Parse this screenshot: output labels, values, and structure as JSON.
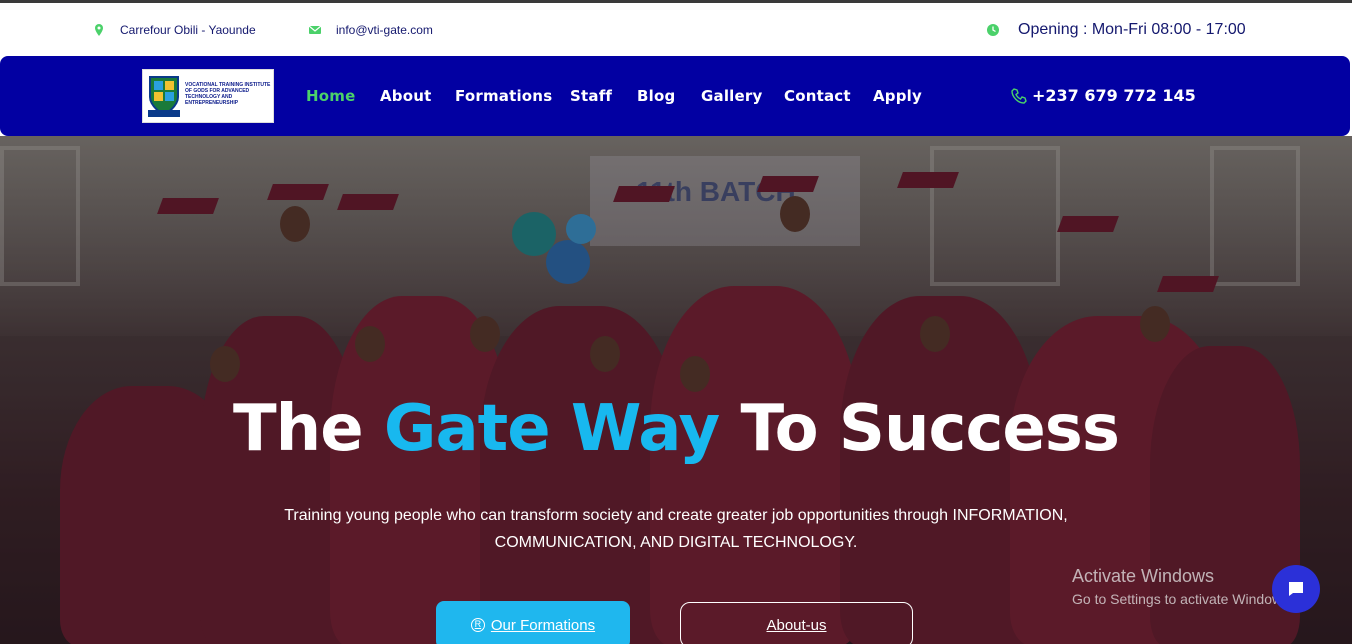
{
  "topbar": {
    "location": "Carrefour Obili - Yaounde",
    "email": "info@vti-gate.com",
    "opening": "Opening : Mon-Fri 08:00 - 17:00"
  },
  "logo": {
    "text": "VOCATIONAL TRAINING INSTITUTE OF GODS FOR ADVANCED TECHNOLOGY AND ENTREPRENEURSHIP",
    "badge": "VTI-GATE"
  },
  "nav": {
    "items": [
      "Home",
      "About",
      "Formations",
      "Staff",
      "Blog",
      "Gallery",
      "Contact",
      "Apply"
    ],
    "active": "Home",
    "phone": "+237 679 772 145"
  },
  "hero": {
    "title_part1": "The",
    "title_highlight": "Gate Way",
    "title_part2": "To Success",
    "subtitle": "Training young people who can transform society and create greater job opportunities through INFORMATION, COMMUNICATION, AND DIGITAL TECHNOLOGY.",
    "btn_formations": "Our Formations",
    "btn_about": "About-us",
    "banner_text": "11th BATCH"
  },
  "watermark": {
    "line1": "Activate Windows",
    "line2": "Go to Settings to activate Windows."
  },
  "colors": {
    "nav_bg": "#0200a2",
    "active_link": "#4bd16a",
    "highlight": "#18b8ef",
    "icon_green": "#4bd16a"
  }
}
